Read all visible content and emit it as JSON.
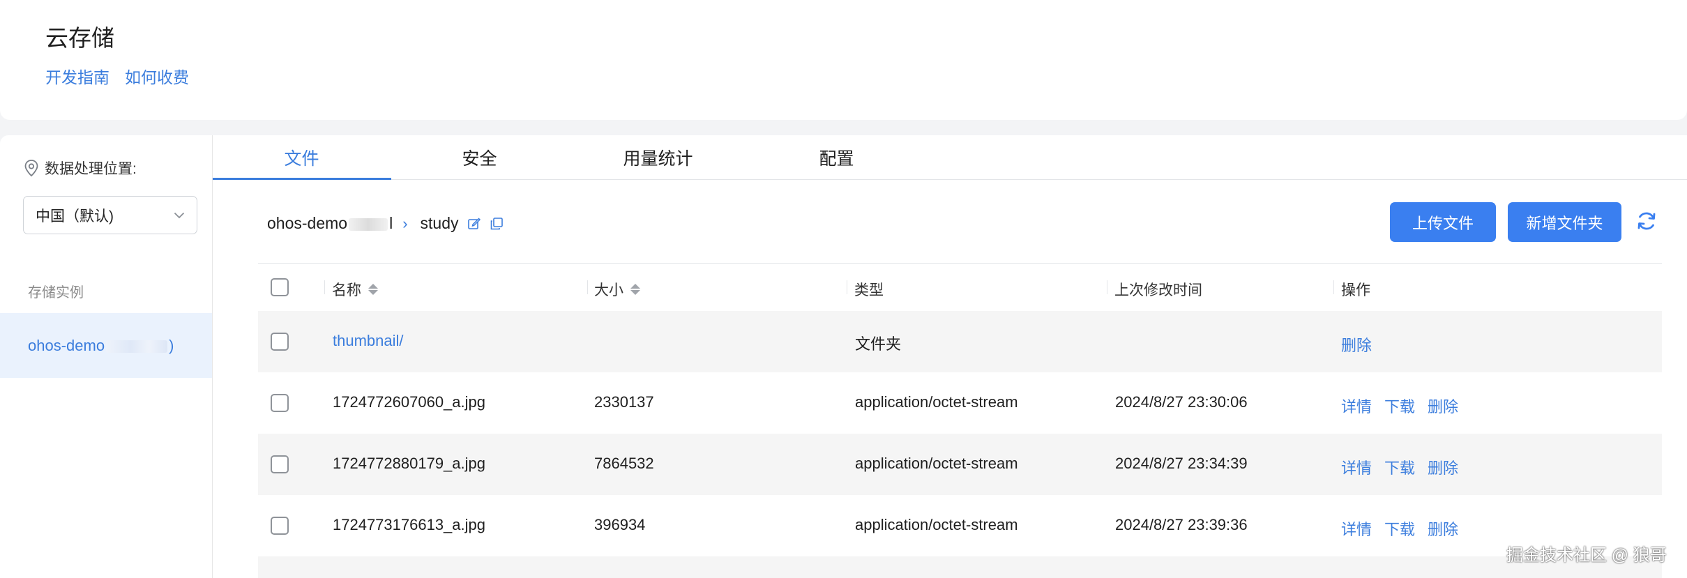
{
  "header": {
    "title": "云存储",
    "links": [
      "开发指南",
      "如何收费"
    ]
  },
  "sidebar": {
    "location_label": "数据处理位置:",
    "region_value": "中国（默认)",
    "instances_label": "存储实例",
    "instance_name_prefix": "ohos-demo",
    "instance_name_suffix": ")"
  },
  "tabs": [
    {
      "label": "文件",
      "active": true
    },
    {
      "label": "安全",
      "active": false
    },
    {
      "label": "用量统计",
      "active": false
    },
    {
      "label": "配置",
      "active": false
    }
  ],
  "breadcrumb": {
    "bucket": "ohos-demo",
    "bucket_tail": "l",
    "folder": "study"
  },
  "buttons": {
    "upload": "上传文件",
    "new_folder": "新增文件夹"
  },
  "table": {
    "headers": {
      "name": "名称",
      "size": "大小",
      "type": "类型",
      "modified": "上次修改时间",
      "actions": "操作"
    },
    "rows": [
      {
        "name": "thumbnail/",
        "size": "",
        "type": "文件夹",
        "modified": "",
        "is_folder": true,
        "actions": [
          "删除"
        ]
      },
      {
        "name": "1724772607060_a.jpg",
        "size": "2330137",
        "type": "application/octet-stream",
        "modified": "2024/8/27 23:30:06",
        "is_folder": false,
        "actions": [
          "详情",
          "下载",
          "删除"
        ]
      },
      {
        "name": "1724772880179_a.jpg",
        "size": "7864532",
        "type": "application/octet-stream",
        "modified": "2024/8/27 23:34:39",
        "is_folder": false,
        "actions": [
          "详情",
          "下载",
          "删除"
        ]
      },
      {
        "name": "1724773176613_a.jpg",
        "size": "396934",
        "type": "application/octet-stream",
        "modified": "2024/8/27 23:39:36",
        "is_folder": false,
        "actions": [
          "详情",
          "下载",
          "删除"
        ]
      }
    ]
  },
  "watermark": "掘金技术社区 @ 狼哥",
  "colors": {
    "accent": "#3b7ddd",
    "button": "#3a7ff0",
    "row_alt": "#f5f5f5",
    "selected_bg": "#eaf2fd"
  }
}
